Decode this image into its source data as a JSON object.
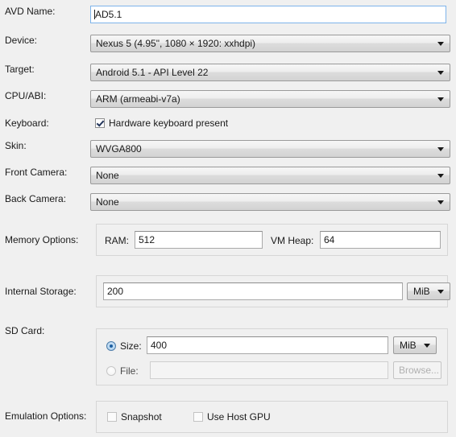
{
  "form": {
    "rows": [
      {
        "label": "AVD Name:",
        "value": "AD5.1"
      },
      {
        "label": "Device:",
        "value": "Nexus 5 (4.95\", 1080 × 1920: xxhdpi)"
      },
      {
        "label": "Target:",
        "value": "Android 5.1 - API Level 22"
      },
      {
        "label": "CPU/ABI:",
        "value": "ARM (armeabi-v7a)"
      },
      {
        "label": "Keyboard:",
        "value": "Hardware keyboard present"
      },
      {
        "label": "Skin:",
        "value": "WVGA800"
      },
      {
        "label": "Front Camera:",
        "value": "None"
      },
      {
        "label": "Back Camera:",
        "value": "None"
      },
      {
        "label": "Memory Options:",
        "value": ""
      },
      {
        "label": "Internal Storage:",
        "value": "200"
      },
      {
        "label": "SD Card:",
        "value": ""
      },
      {
        "label": "Emulation Options:",
        "value": ""
      }
    ],
    "keyboard": {
      "checkbox_label": "Hardware keyboard present",
      "checked": "true"
    },
    "memory": {
      "ram_label": "RAM:",
      "ram_value": "512",
      "vmheap_label": "VM Heap:",
      "vmheap_value": "64"
    },
    "internal_storage": {
      "value": "200",
      "unit": "MiB"
    },
    "sdcard": {
      "size_label": "Size:",
      "size_value": "400",
      "size_unit": "MiB",
      "file_label": "File:",
      "file_value": "",
      "file_placeholder": "",
      "browse_label": "Browse..."
    },
    "emulation": {
      "snapshot_label": "Snapshot",
      "snapshot_checked": "false",
      "hostgpu_label": "Use Host GPU",
      "hostgpu_checked": "false"
    }
  },
  "colors": {
    "window_background": "#f0f0f0",
    "focused_border": "#7eb4ea",
    "radio_accent": "#1d5fa0",
    "text": "#1a1a1a",
    "disabled_text": "#b0b0b0"
  }
}
